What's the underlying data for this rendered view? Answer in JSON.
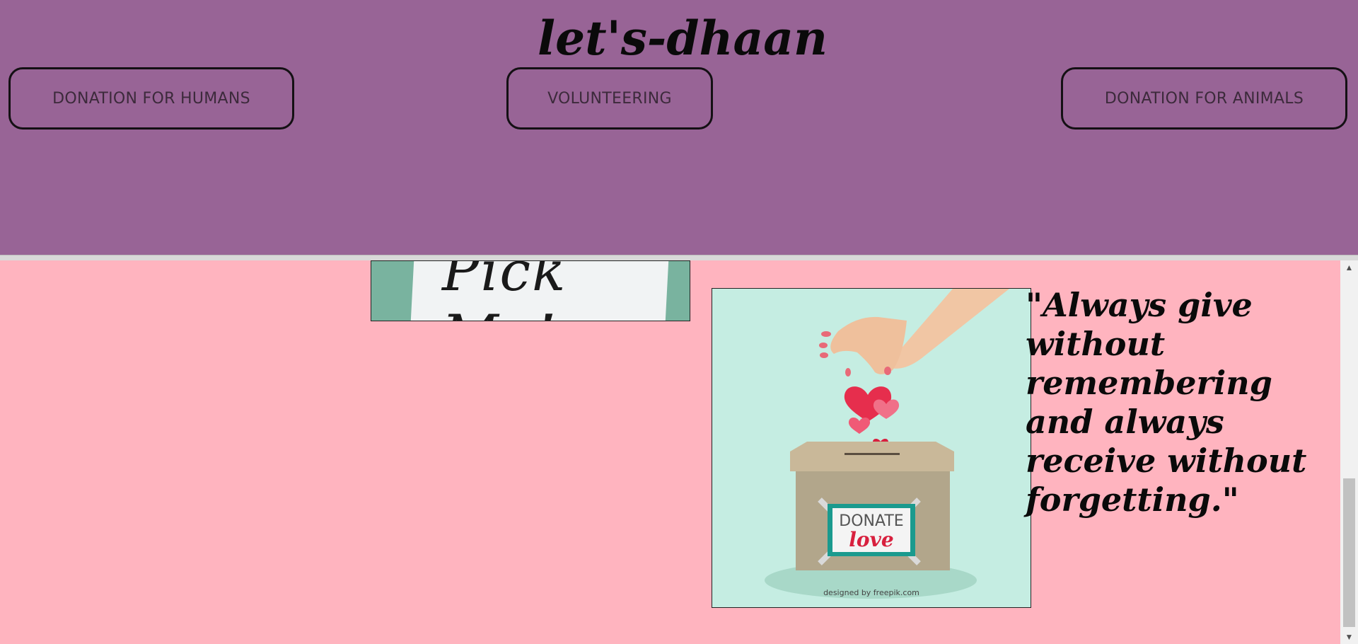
{
  "header": {
    "site_title": "let's-dhaan",
    "background": "#986496"
  },
  "nav": {
    "humans_label": "DONATION FOR HUMANS",
    "volunteering_label": "VOLUNTEERING",
    "animals_label": "DONATION FOR ANIMALS"
  },
  "images": {
    "pick_me_text": "Pick Me!",
    "donate_box_word": "DONATE",
    "donate_box_love": "love",
    "credit": "designed by freepik.com"
  },
  "quote": {
    "text": "\"Always give without remembering and always receive without forgetting.\""
  },
  "colors": {
    "page_background": "#ffb4bf",
    "image_background": "#c5ede2",
    "heart": "#e62e4d"
  },
  "scrollbar": {
    "up_icon": "triangle-up",
    "down_icon": "triangle-down"
  }
}
